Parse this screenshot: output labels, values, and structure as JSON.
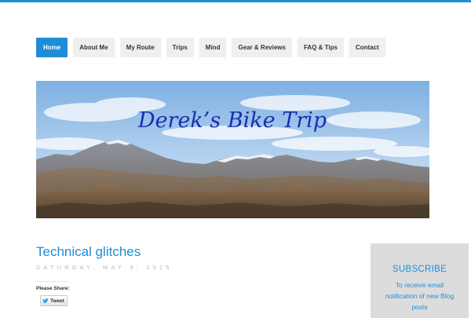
{
  "nav": {
    "items": [
      {
        "label": "Home",
        "active": true
      },
      {
        "label": "About Me"
      },
      {
        "label": "My Route"
      },
      {
        "label": "Trips"
      },
      {
        "label": "Mind"
      },
      {
        "label": "Gear & Reviews"
      },
      {
        "label": "FAQ & Tips"
      },
      {
        "label": "Contact"
      }
    ]
  },
  "header": {
    "site_title": "Derek’s Bike Trip"
  },
  "post": {
    "title": "Technical glitches",
    "date": "SATURDAY, MAY 9, 2015",
    "share_label": "Please Share:",
    "tweet_label": "Tweet",
    "tweet_icon": "twitter-bird-icon"
  },
  "sidebar": {
    "subscribe_title": "SUBSCRIBE",
    "subscribe_text": "To receive email notification of new Blog posts"
  },
  "colors": {
    "accent": "#1f8dd6",
    "nav_bg": "#efefef",
    "sidebar_bg": "#dcdcdc",
    "date_text": "#b9b9b9"
  }
}
